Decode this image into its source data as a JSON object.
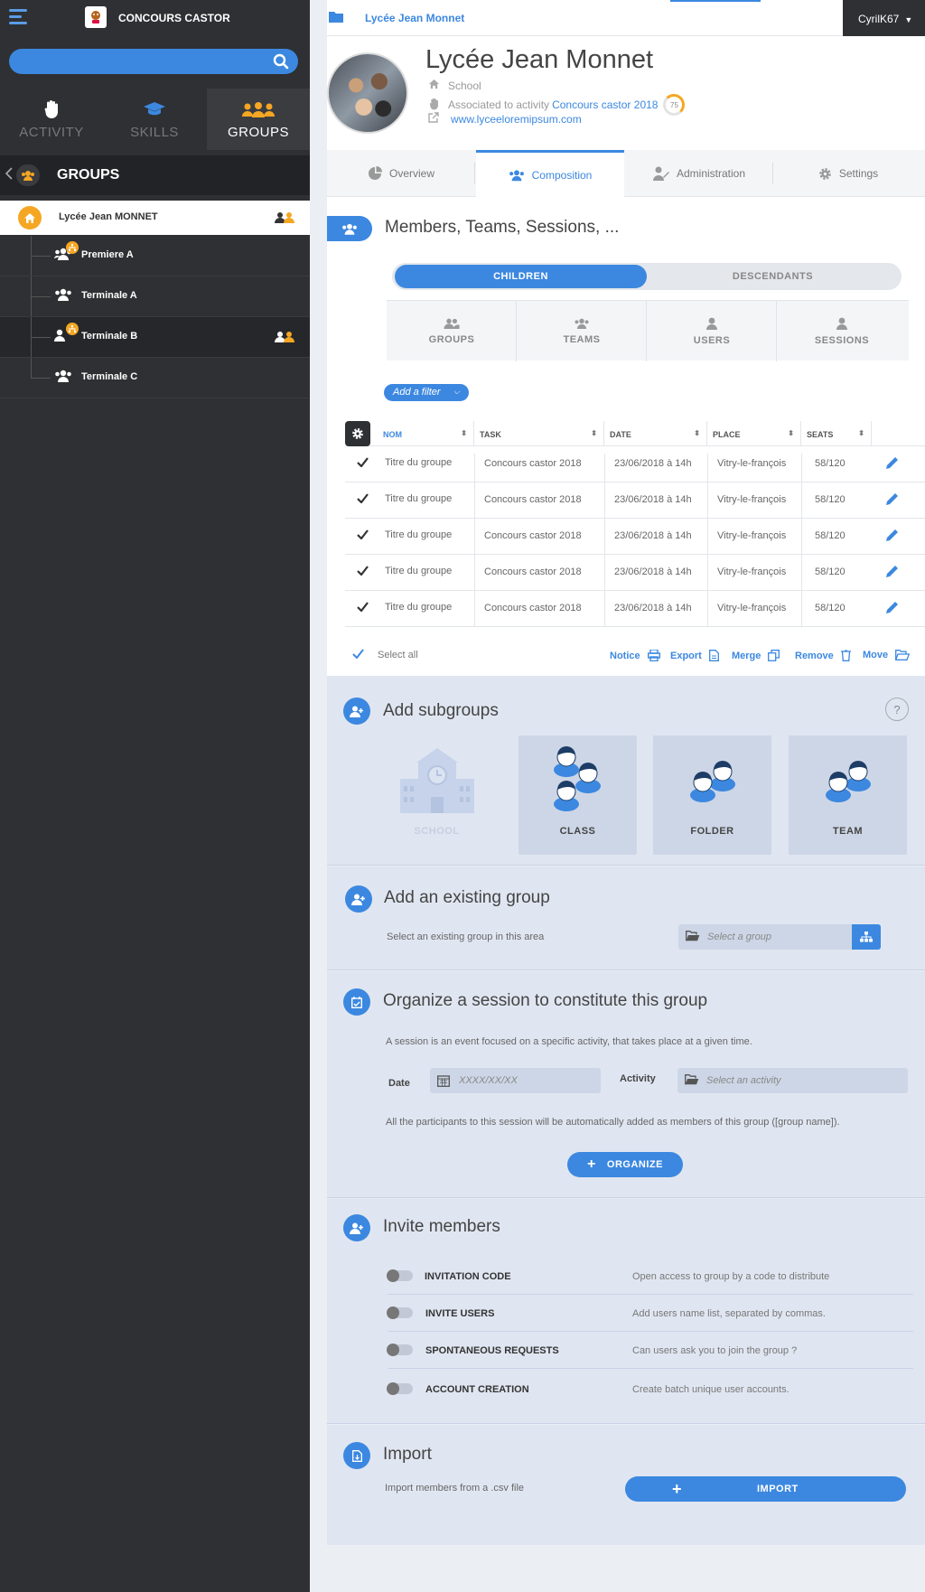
{
  "app": {
    "brand": "CONCOURS CASTOR",
    "user": "CyrilK67"
  },
  "search": {
    "placeholder": ""
  },
  "nav": {
    "tabs": [
      {
        "label": "ACTIVITY"
      },
      {
        "label": "SKILLS"
      },
      {
        "label": "GROUPS"
      }
    ]
  },
  "groups_panel": {
    "title": "GROUPS",
    "school": "Lycée Jean MONNET",
    "items": [
      {
        "label": "Premiere A"
      },
      {
        "label": "Terminale A"
      },
      {
        "label": "Terminale B"
      },
      {
        "label": "Terminale C"
      }
    ]
  },
  "breadcrumb": "Lycée Jean Monnet",
  "header": {
    "title": "Lycée Jean Monnet",
    "type": "School",
    "associated_prefix": "Associated to activity",
    "activity_link": "Concours castor 2018",
    "score": "75",
    "website": "www.lyceeloremipsum.com"
  },
  "tabs": [
    {
      "label": "Overview"
    },
    {
      "label": "Composition"
    },
    {
      "label": "Administration"
    },
    {
      "label": "Settings"
    }
  ],
  "members": {
    "title": "Members, Teams, Sessions, ...",
    "toggle": {
      "on": "CHILDREN",
      "off": "DESCENDANTS"
    },
    "categories": [
      {
        "label": "GROUPS"
      },
      {
        "label": "TEAMS"
      },
      {
        "label": "USERS"
      },
      {
        "label": "SESSIONS"
      }
    ],
    "filter": "Add a filter",
    "columns": [
      "NOM",
      "TASK",
      "DATE",
      "PLACE",
      "SEATS"
    ],
    "rows": [
      {
        "nom": "Titre du groupe",
        "task": "Concours castor 2018",
        "date": "23/06/2018 à 14h",
        "place": "Vitry-le-françois",
        "seats": "58/120"
      },
      {
        "nom": "Titre du groupe",
        "task": "Concours castor 2018",
        "date": "23/06/2018 à 14h",
        "place": "Vitry-le-françois",
        "seats": "58/120"
      },
      {
        "nom": "Titre du groupe",
        "task": "Concours castor 2018",
        "date": "23/06/2018 à 14h",
        "place": "Vitry-le-françois",
        "seats": "58/120"
      },
      {
        "nom": "Titre du groupe",
        "task": "Concours castor 2018",
        "date": "23/06/2018 à 14h",
        "place": "Vitry-le-françois",
        "seats": "58/120"
      },
      {
        "nom": "Titre du groupe",
        "task": "Concours castor 2018",
        "date": "23/06/2018 à 14h",
        "place": "Vitry-le-françois",
        "seats": "58/120"
      }
    ],
    "select_all": "Select all",
    "actions": {
      "notice": "Notice",
      "export": "Export",
      "merge": "Merge",
      "remove": "Remove",
      "move": "Move"
    }
  },
  "subgroups": {
    "title": "Add subgroups",
    "help": "?",
    "options": [
      {
        "label": "SCHOOL"
      },
      {
        "label": "CLASS"
      },
      {
        "label": "FOLDER"
      },
      {
        "label": "TEAM"
      }
    ]
  },
  "existing": {
    "title": "Add an existing group",
    "desc": "Select an existing group in this area",
    "placeholder": "Select a group"
  },
  "session": {
    "title": "Organize a session to constitute this group",
    "desc": "A session is an event focused on a specific activity, that takes place at a given time.",
    "date_label": "Date",
    "date_placeholder": "XXXX/XX/XX",
    "activity_label": "Activity",
    "activity_placeholder": "Select an activity",
    "note": "All the participants to this session will be automatically added as members of this group ([group name]).",
    "button": "ORGANIZE"
  },
  "invite": {
    "title": "Invite members",
    "rows": [
      {
        "label": "INVITATION CODE",
        "desc": "Open access to group by a code to distribute"
      },
      {
        "label": "INVITE USERS",
        "desc": "Add users name list, separated by commas."
      },
      {
        "label": "SPONTANEOUS REQUESTS",
        "desc": "Can users ask you to join the group ?"
      },
      {
        "label": "ACCOUNT CREATION",
        "desc": "Create batch unique user accounts."
      }
    ]
  },
  "import": {
    "title": "Import",
    "desc": "Import members from a .csv file",
    "button": "IMPORT"
  }
}
